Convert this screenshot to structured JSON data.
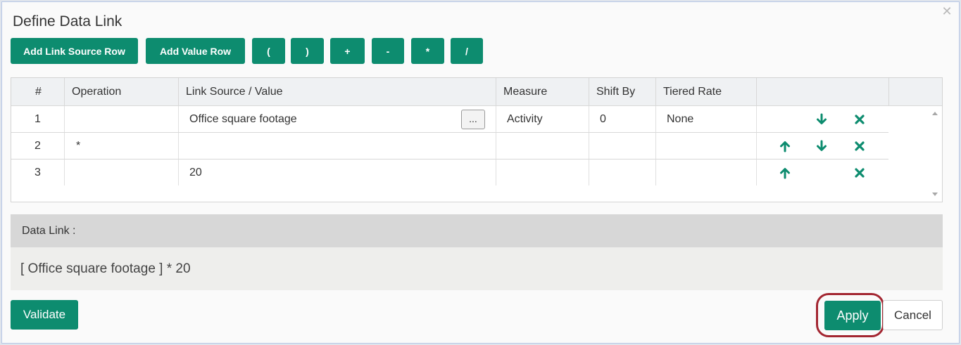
{
  "dialog": {
    "title": "Define Data Link",
    "close_icon": "close-icon"
  },
  "toolbar": {
    "add_link_source_row": "Add Link Source Row",
    "add_value_row": "Add Value Row",
    "operators": [
      "(",
      ")",
      "+",
      "-",
      "*",
      "/"
    ]
  },
  "grid": {
    "columns": [
      "#",
      "Operation",
      "Link Source / Value",
      "Measure",
      "Shift By",
      "Tiered Rate"
    ],
    "rows": [
      {
        "num": "1",
        "operation": "",
        "source": "Office square footage",
        "has_lookup": true,
        "lookup_label": "...",
        "measure": "Activity",
        "shift_by": "0",
        "tiered_rate": "None",
        "actions": [
          "arrow-down-icon",
          "delete-icon"
        ]
      },
      {
        "num": "2",
        "operation": "*",
        "source": "",
        "has_lookup": false,
        "measure": "",
        "shift_by": "",
        "tiered_rate": "",
        "actions": [
          "arrow-up-icon",
          "arrow-down-icon",
          "delete-icon"
        ]
      },
      {
        "num": "3",
        "operation": "",
        "source": "20",
        "has_lookup": false,
        "measure": "",
        "shift_by": "",
        "tiered_rate": "",
        "actions": [
          "arrow-up-icon",
          "delete-icon"
        ]
      }
    ]
  },
  "data_link": {
    "label": "Data Link :",
    "expression": "[ Office square footage ] * 20"
  },
  "footer": {
    "validate": "Validate",
    "apply": "Apply",
    "cancel": "Cancel"
  },
  "colors": {
    "accent": "#0d8c6f",
    "highlight_ring": "#a32631"
  }
}
